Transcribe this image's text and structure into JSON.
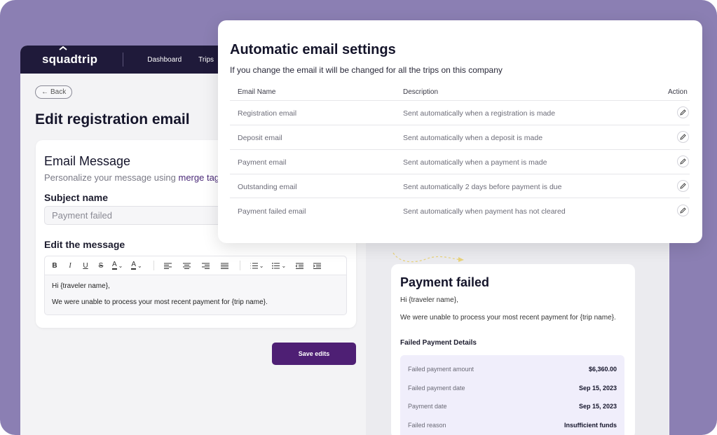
{
  "topbar": {
    "logo": "squadtrip",
    "nav": [
      "Dashboard",
      "Trips"
    ]
  },
  "page": {
    "back_label": "Back",
    "title": "Edit registration email"
  },
  "email_card": {
    "title": "Email Message",
    "subtitle_prefix": "Personalize your message using ",
    "subtitle_link": "merge tag",
    "subject_label": "Subject name",
    "subject_value": "Payment failed",
    "message_label": "Edit the message",
    "toolbar": [
      "bold-icon",
      "italic-icon",
      "underline-icon",
      "strikethrough-icon",
      "font-color-icon",
      "highlight-color-icon",
      "align-left-icon",
      "align-center-icon",
      "align-right-icon",
      "align-justify-icon",
      "ordered-list-icon",
      "bullet-list-icon",
      "outdent-icon",
      "indent-icon"
    ],
    "message_lines": [
      "Hi {traveler name},",
      "We were unable to process your most recent payment for {trip name}."
    ],
    "save_label": "Save edits"
  },
  "preview": {
    "title": "Payment failed",
    "greeting": "Hi {traveler name},",
    "body": "We were unable to process your most recent payment for {trip name}.",
    "details_title": "Failed Payment Details",
    "details": [
      {
        "label": "Failed payment amount",
        "value": "$6,360.00"
      },
      {
        "label": "Failed payment date",
        "value": "Sep 15, 2023"
      },
      {
        "label": "Payment date",
        "value": "Sep 15, 2023"
      },
      {
        "label": "Failed reason",
        "value": "Insufficient funds"
      }
    ]
  },
  "modal": {
    "title": "Automatic email settings",
    "subtitle": "If you change the email it will be changed for all the trips on this company",
    "columns": {
      "name": "Email Name",
      "description": "Description",
      "action": "Action"
    },
    "rows": [
      {
        "name": "Registration email",
        "description": "Sent automatically when a registration is made"
      },
      {
        "name": "Deposit email",
        "description": "Sent automatically when a deposit is made"
      },
      {
        "name": "Payment email",
        "description": "Sent automatically when a payment is made"
      },
      {
        "name": "Outstanding email",
        "description": "Sent automatically 2 days before payment is due"
      },
      {
        "name": "Payment failed email",
        "description": "Sent automatically when payment has not cleared"
      }
    ]
  },
  "colors": {
    "background": "#8b7fb3",
    "topbar": "#1f1a3a",
    "primary_button": "#4e1f74",
    "details_bg": "#f0eefb"
  }
}
